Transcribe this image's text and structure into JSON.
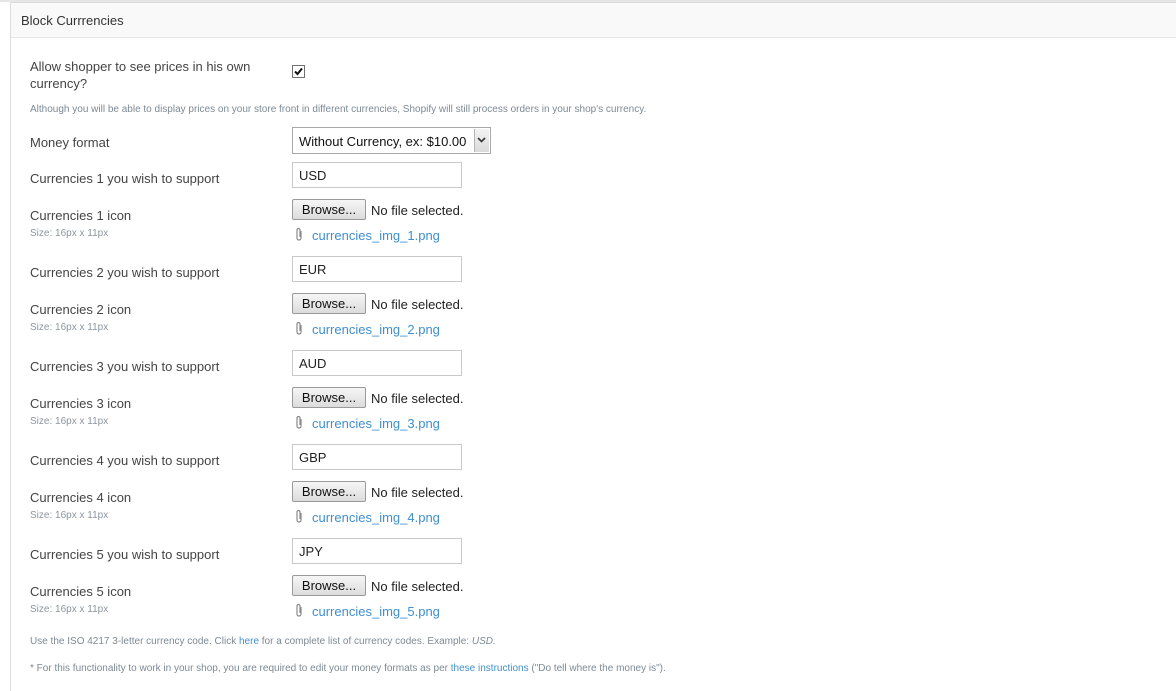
{
  "panel": {
    "title": "Block Currrencies"
  },
  "allow": {
    "label_line1": "Allow shopper to see prices in his own",
    "label_line2": "currency?",
    "checked": true,
    "note": "Although you will be able to display prices on your store front in different currencies, Shopify will still process orders in your shop's currency."
  },
  "money_format": {
    "label": "Money format",
    "selected": "Without Currency, ex: $10.00"
  },
  "currencies": [
    {
      "label": "Currencies 1 you wish to support",
      "code": "USD",
      "icon_label": "Currencies 1 icon",
      "size_hint": "Size: 16px x 11px",
      "browse": "Browse...",
      "no_file": "No file selected.",
      "file": "currencies_img_1.png"
    },
    {
      "label": "Currencies 2 you wish to support",
      "code": "EUR",
      "icon_label": "Currencies 2 icon",
      "size_hint": "Size: 16px x 11px",
      "browse": "Browse...",
      "no_file": "No file selected.",
      "file": "currencies_img_2.png"
    },
    {
      "label": "Currencies 3 you wish to support",
      "code": "AUD",
      "icon_label": "Currencies 3 icon",
      "size_hint": "Size: 16px x 11px",
      "browse": "Browse...",
      "no_file": "No file selected.",
      "file": "currencies_img_3.png"
    },
    {
      "label": "Currencies 4 you wish to support",
      "code": "GBP",
      "icon_label": "Currencies 4 icon",
      "size_hint": "Size: 16px x 11px",
      "browse": "Browse...",
      "no_file": "No file selected.",
      "file": "currencies_img_4.png"
    },
    {
      "label": "Currencies 5 you wish to support",
      "code": "JPY",
      "icon_label": "Currencies 5 icon",
      "size_hint": "Size: 16px x 11px",
      "browse": "Browse...",
      "no_file": "No file selected.",
      "file": "currencies_img_5.png"
    }
  ],
  "footer": {
    "iso_before": "Use the ISO 4217 3-letter currency code. Click ",
    "iso_link": "here",
    "iso_after": " for a complete list of currency codes. Example: ",
    "iso_example": "USD.",
    "req_before": "* For this functionality to work in your shop, you are required to edit your money formats as per ",
    "req_link": "these instructions",
    "req_after": " (\"Do tell where the money is\")."
  },
  "colors": {
    "link": "#3f8fd2",
    "hint": "#8c96a0",
    "header_bg": "#f8f9f8"
  }
}
